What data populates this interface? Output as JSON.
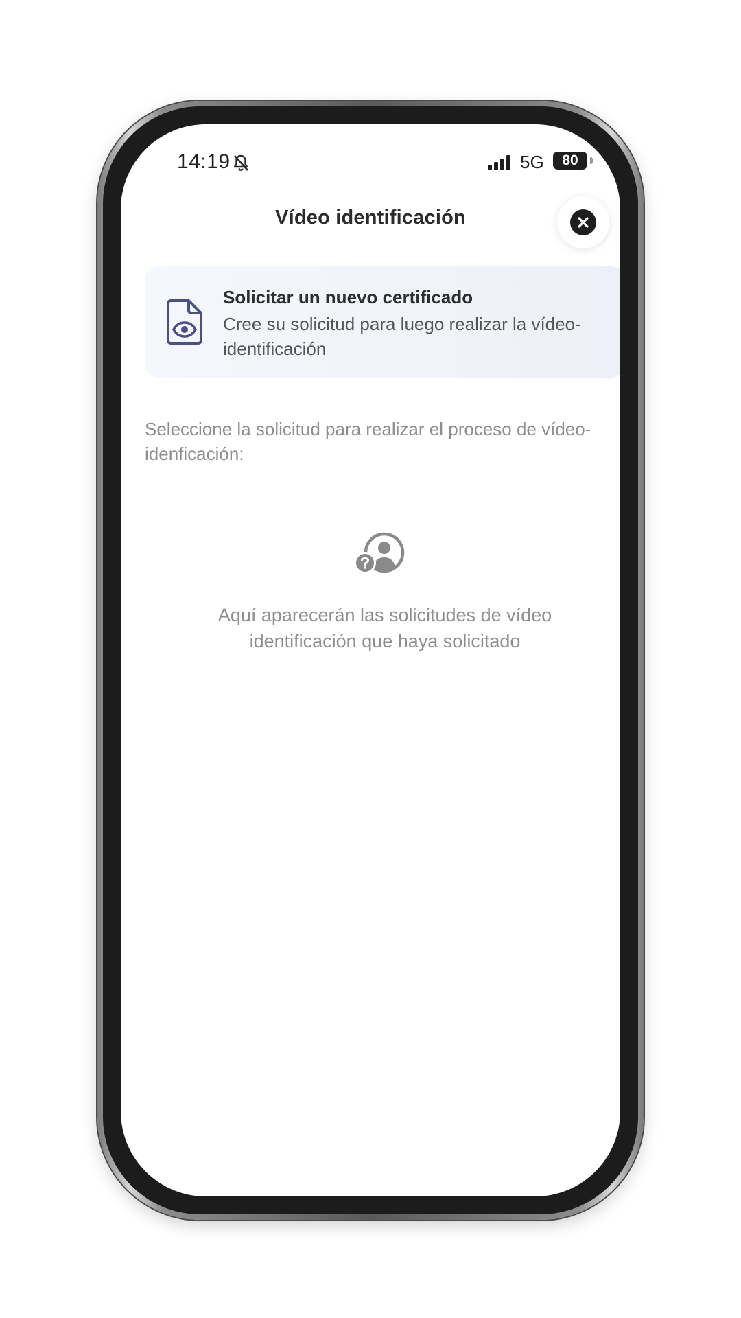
{
  "status_bar": {
    "time": "14:19",
    "network": "5G",
    "battery": "80"
  },
  "header": {
    "title": "Vídeo identificación"
  },
  "request_card": {
    "title": "Solicitar un nuevo certificado",
    "description": "Cree su solicitud para luego realizar la vídeo-identificación"
  },
  "instruction": "Seleccione la solicitud para realizar el proceso de vídeo-idenficación:",
  "empty_state": {
    "message": "Aquí aparecerán las solicitudes de vídeo identificación que haya solicitado"
  },
  "icons": {
    "silent": "bell-slash-icon",
    "signal": "cellular-signal-icon",
    "close": "close-icon",
    "document": "document-eye-icon",
    "empty": "user-question-icon"
  },
  "colors": {
    "card_icon": "#4a4f86",
    "muted_text": "#8e8e8e",
    "card_background": "#eef2f7"
  }
}
